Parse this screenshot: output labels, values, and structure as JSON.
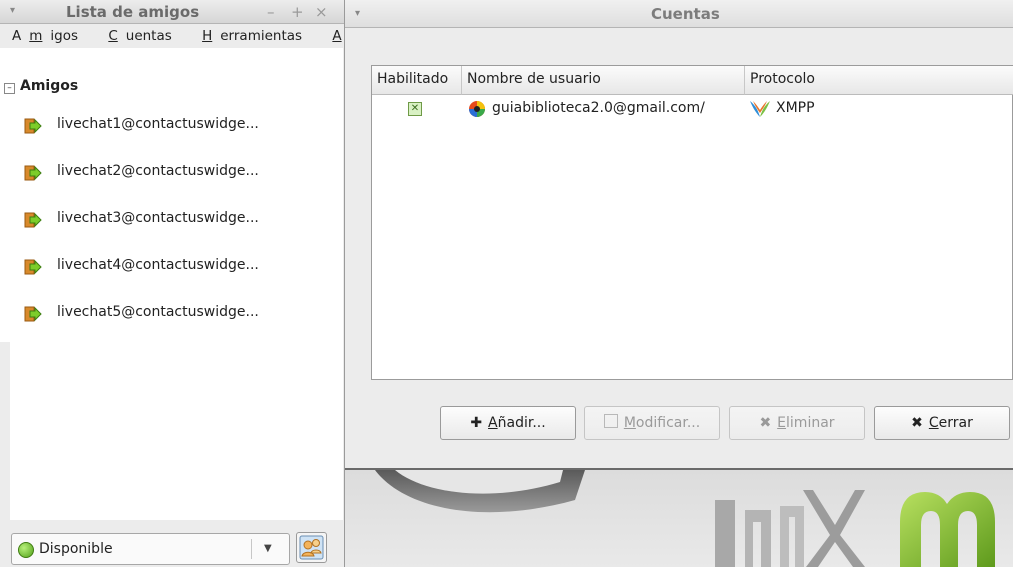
{
  "buddy_window": {
    "title": "Lista de amigos",
    "menu_glyph": "▾",
    "title_buttons": [
      "–",
      "+",
      "×"
    ],
    "menu_items": [
      {
        "pre": "A",
        "key": "m",
        "post": "igos"
      },
      {
        "pre": "",
        "key": "C",
        "post": "uentas"
      },
      {
        "pre": "",
        "key": "H",
        "post": "erramientas"
      },
      {
        "pre": "",
        "key": "A",
        "post": "yuda"
      }
    ],
    "group": {
      "name": "Amigos",
      "toggle": "–"
    },
    "buddies": [
      {
        "name": "livechat1@contactuswidge...",
        "icon": "away-arrow-icon"
      },
      {
        "name": "livechat2@contactuswidge...",
        "icon": "away-arrow-icon"
      },
      {
        "name": "livechat3@contactuswidge...",
        "icon": "away-arrow-icon"
      },
      {
        "name": "livechat4@contactuswidge...",
        "icon": "away-arrow-icon"
      },
      {
        "name": "livechat5@contactuswidge...",
        "icon": "away-arrow-icon"
      }
    ],
    "status": {
      "label": "Disponible",
      "arrow": "▼",
      "color": "#52a11a"
    }
  },
  "accounts_window": {
    "title": "Cuentas",
    "menu_glyph": "▾",
    "columns": [
      "Habilitado",
      "Nombre de usuario",
      "Protocolo"
    ],
    "rows": [
      {
        "enabled": true,
        "check_glyph": "✕",
        "username": "guiabiblioteca2.0@gmail.com/",
        "protocol": "XMPP"
      }
    ],
    "buttons": [
      {
        "icon": "plus-icon",
        "glyph": "✚",
        "mnemonic": "A",
        "rest": "ñadir...",
        "enabled": true
      },
      {
        "icon": "edit-icon",
        "glyph": "",
        "mnemonic": "M",
        "rest": "odificar...",
        "enabled": false
      },
      {
        "icon": "delete-icon",
        "glyph": "✖",
        "mnemonic": "E",
        "rest": "liminar",
        "enabled": false
      },
      {
        "icon": "close-icon",
        "glyph": "✖",
        "mnemonic": "C",
        "rest": "errar",
        "enabled": true
      }
    ]
  },
  "colors": {
    "accent_green": "#7ab32e",
    "checkbox_green": "#d9f1c4",
    "window_bg": "#ececec"
  }
}
